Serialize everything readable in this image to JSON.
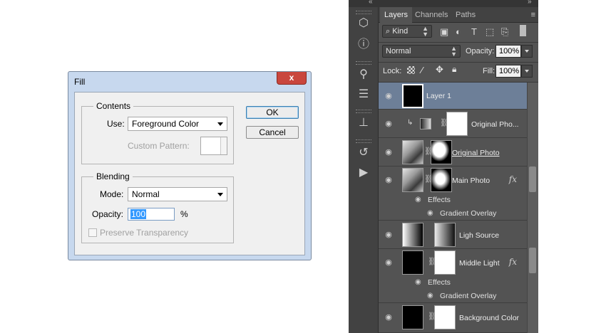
{
  "fill_dialog": {
    "title": "Fill",
    "close_label": "x",
    "contents": {
      "group_label": "Contents",
      "use_label": "Use:",
      "use_value": "Foreground Color",
      "custom_pattern_label": "Custom Pattern:"
    },
    "blending": {
      "group_label": "Blending",
      "mode_label": "Mode:",
      "mode_value": "Normal",
      "opacity_label": "Opacity:",
      "opacity_value": "100",
      "opacity_unit": "%",
      "preserve_label": "Preserve Transparency",
      "preserve_checked": false
    },
    "ok_label": "OK",
    "cancel_label": "Cancel"
  },
  "layers_panel": {
    "collapse_left": "«",
    "collapse_right": "»",
    "tabs": [
      "Layers",
      "Channels",
      "Paths"
    ],
    "active_tab": "Layers",
    "menu_icon": "≡",
    "filter_kind": "Kind",
    "blend_mode": "Normal",
    "opacity_label": "Opacity:",
    "opacity_value": "100%",
    "lock_label": "Lock:",
    "fill_label": "Fill:",
    "fill_value": "100%",
    "layers": [
      {
        "name": "Layer 1",
        "selected": true
      },
      {
        "name": "Original Pho..."
      },
      {
        "name": "Original Photo"
      },
      {
        "name": "Main Photo",
        "effects_label": "Effects",
        "effect": "Gradient Overlay",
        "fx": "fx"
      },
      {
        "name": "Ligh Source"
      },
      {
        "name": "Middle Light",
        "effects_label": "Effects",
        "effect": "Gradient Overlay",
        "fx": "fx"
      },
      {
        "name": "Background Color"
      }
    ]
  },
  "icons": {
    "eye": "eye-icon",
    "link": "chain-link-icon",
    "clip": "clipping-arrow-icon",
    "lock_pixels": "checkerboard-icon",
    "lock_brush": "brush-icon",
    "lock_move": "move-icon",
    "lock_all": "padlock-icon"
  }
}
